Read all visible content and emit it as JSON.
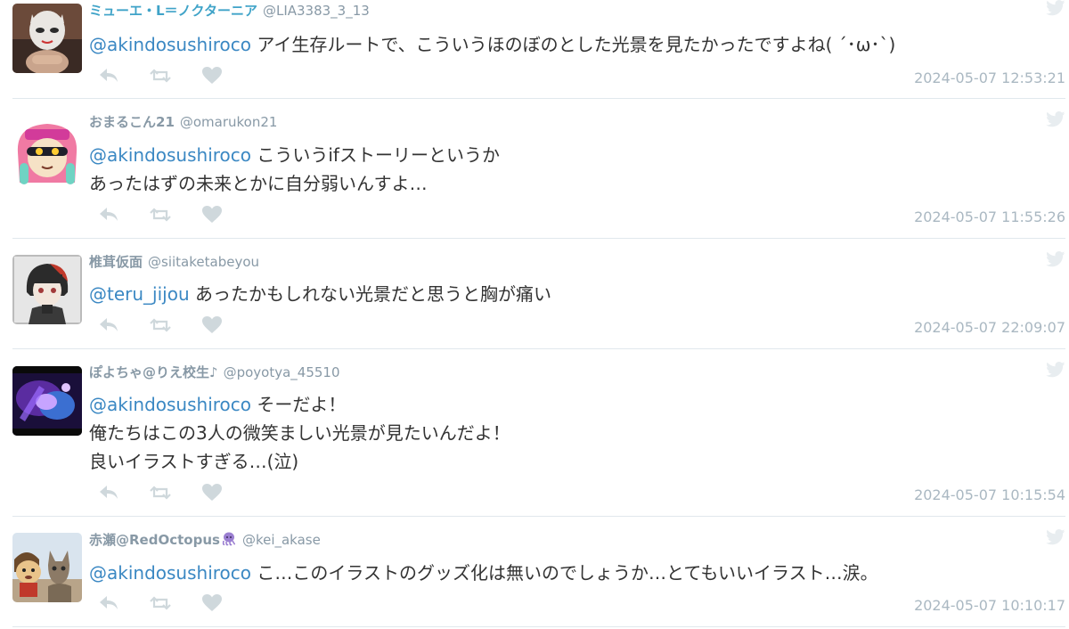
{
  "tweets": [
    {
      "display_name": "ミューエ・L＝ノクターニア",
      "handle": "@LIA3383_3_13",
      "mention": "@akindosushiroco",
      "lines": [
        "アイ生存ルートで、こういうほのぼのとした光景を見たかったですよね( ´･ω･`)"
      ],
      "timestamp": "2024-05-07 12:53:21",
      "avatar_icon": "masked-person-avatar",
      "name_color": "#3fa3c8"
    },
    {
      "display_name": "おまるこん21",
      "handle": "@omarukon21",
      "mention": "@akindosushiroco",
      "lines": [
        "こういうifストーリーというか",
        "あったはずの未来とかに自分弱いんすよ…"
      ],
      "timestamp": "2024-05-07 11:55:26",
      "avatar_icon": "squid-girl-avatar",
      "name_color": "#8899a6"
    },
    {
      "display_name": "椎茸仮面",
      "handle": "@siitaketabeyou",
      "mention": "@teru_jijou",
      "lines": [
        "あったかもしれない光景だと思うと胸が痛い"
      ],
      "timestamp": "2024-05-07 22:09:07",
      "avatar_icon": "anime-character-avatar",
      "name_color": "#8899a6"
    },
    {
      "display_name": "ぽよちゃ@りえ校生♪",
      "handle": "@poyotya_45510",
      "mention": "@akindosushiroco",
      "lines": [
        "そーだよ！",
        "俺たちはこの3人の微笑ましい光景が見たいんだよ！",
        "良いイラストすぎる…(泣)"
      ],
      "timestamp": "2024-05-07 10:15:54",
      "avatar_icon": "purple-glow-avatar",
      "name_color": "#8899a6"
    },
    {
      "display_name": "赤瀬@RedOctopus",
      "handle": "@kei_akase",
      "mention": "@akindosushiroco",
      "lines": [
        "こ…このイラストのグッズ化は無いのでしょうか…とてもいいイラスト…涙。"
      ],
      "timestamp": "2024-05-07 10:10:17",
      "avatar_icon": "cat-and-mascot-avatar",
      "name_color": "#8899a6",
      "name_emoji": "octopus-icon"
    }
  ],
  "icons": {
    "reply": "reply-icon",
    "retweet": "retweet-icon",
    "like": "heart-icon",
    "brand": "twitter-bird-icon"
  },
  "colors": {
    "mention": "#3b88c3",
    "muted": "#aab8c2",
    "divider": "#e1e8ed",
    "icon": "#cfd8dc"
  }
}
